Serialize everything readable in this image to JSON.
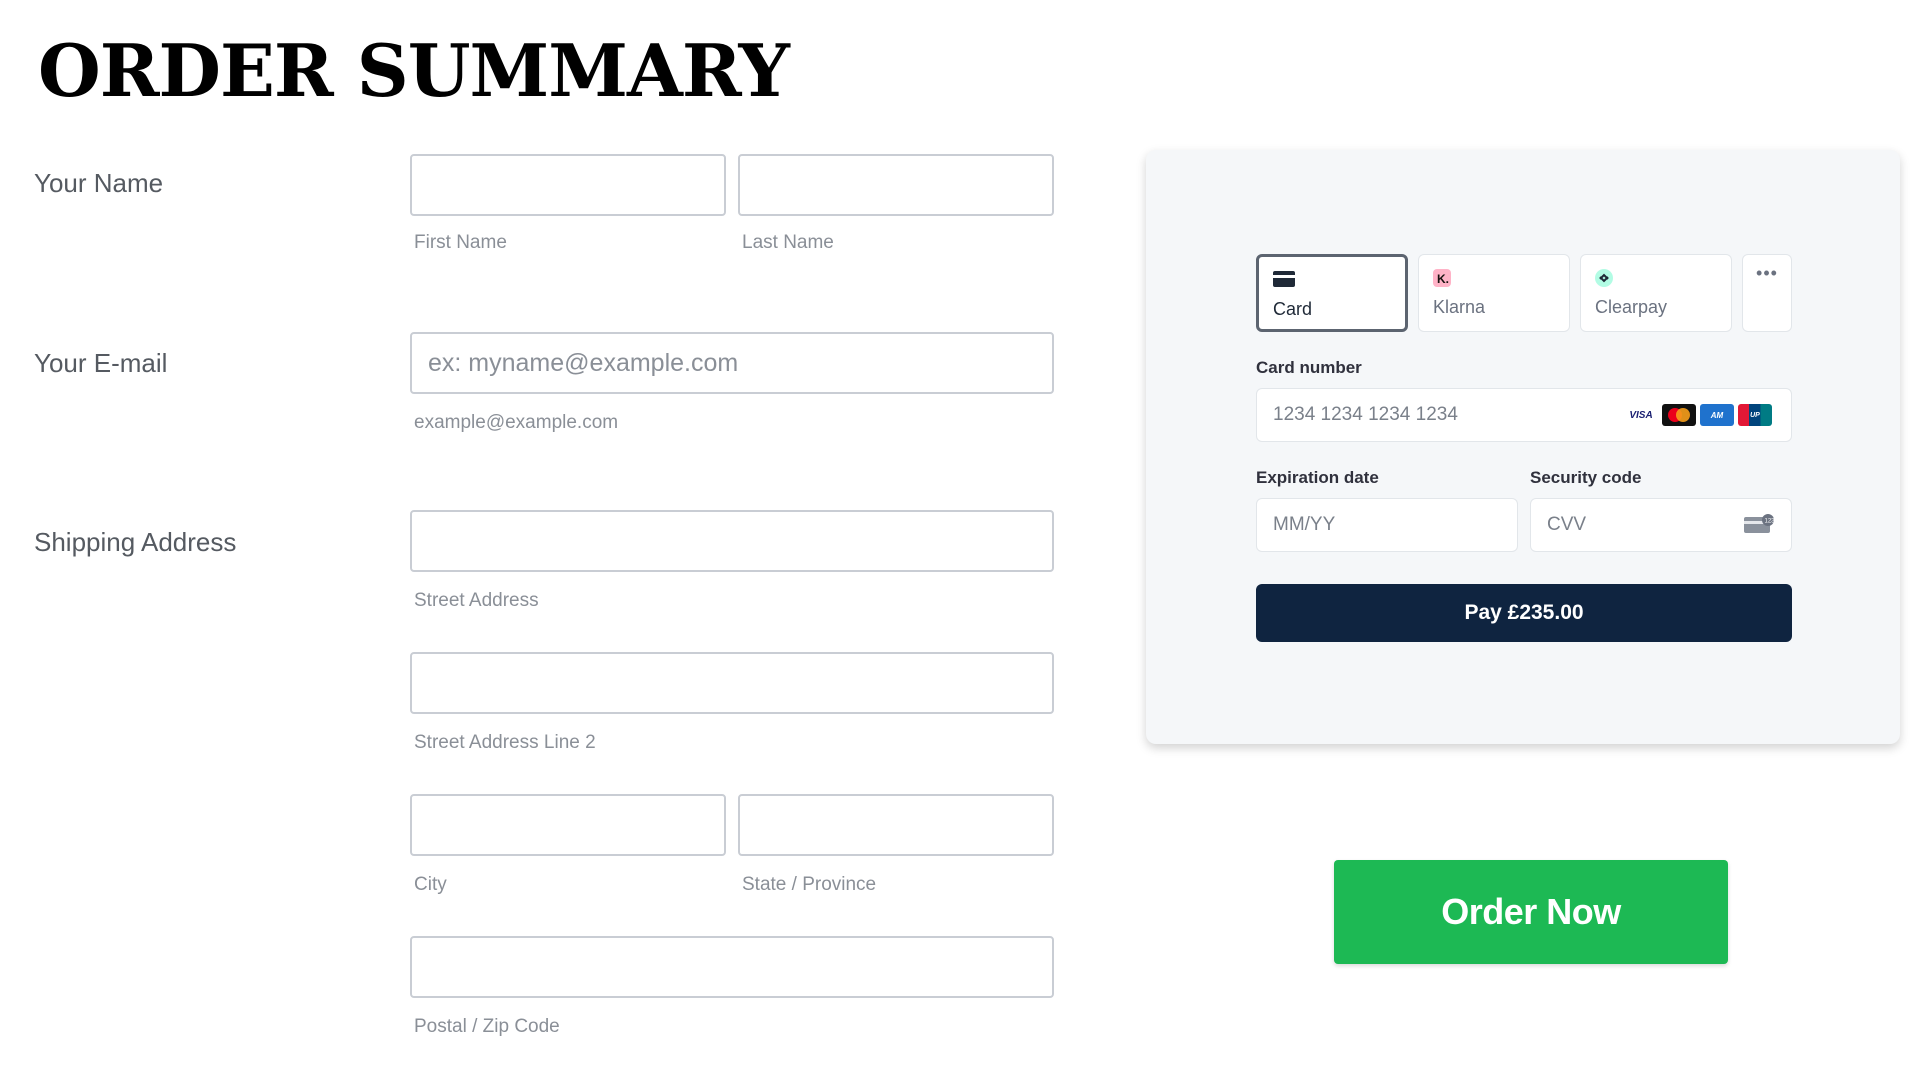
{
  "page": {
    "title": "ORDER SUMMARY"
  },
  "form": {
    "name": {
      "label": "Your Name",
      "first": {
        "value": "",
        "sublabel": "First Name"
      },
      "last": {
        "value": "",
        "sublabel": "Last Name"
      }
    },
    "email": {
      "label": "Your E-mail",
      "placeholder": "ex: myname@example.com",
      "value": "",
      "sublabel": "example@example.com"
    },
    "address": {
      "label": "Shipping Address",
      "street": {
        "value": "",
        "sublabel": "Street Address"
      },
      "street2": {
        "value": "",
        "sublabel": "Street Address Line 2"
      },
      "city": {
        "value": "",
        "sublabel": "City"
      },
      "state": {
        "value": "",
        "sublabel": "State / Province"
      },
      "postal": {
        "value": "",
        "sublabel": "Postal / Zip Code"
      }
    }
  },
  "payment": {
    "tabs": [
      {
        "label": "Card",
        "icon": "card-icon",
        "active": true
      },
      {
        "label": "Klarna",
        "icon": "klarna-icon",
        "active": false
      },
      {
        "label": "Clearpay",
        "icon": "clearpay-icon",
        "active": false
      }
    ],
    "more": {
      "icon": "more-icon"
    },
    "card_number": {
      "label": "Card number",
      "placeholder": "1234 1234 1234 1234"
    },
    "card_brands": [
      "VISA",
      "mastercard",
      "amex",
      "unionpay"
    ],
    "expiry": {
      "label": "Expiration date",
      "placeholder": "MM/YY"
    },
    "cvc": {
      "label": "Security code",
      "placeholder": "CVV"
    },
    "pay_button": "Pay £235.00"
  },
  "order_button": "Order Now",
  "colors": {
    "accent_green": "#1db954",
    "pay_button_bg": "#0f2440",
    "panel_bg": "#f5f7f9"
  }
}
